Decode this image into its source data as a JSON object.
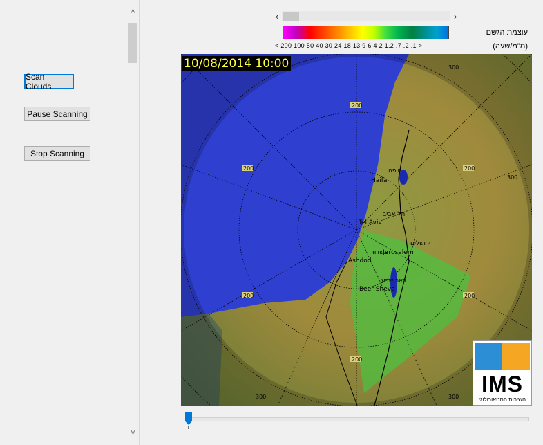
{
  "controls": {
    "scan_clouds": "Scan Clouds",
    "pause_scanning": "Pause Scanning",
    "stop_scanning": "Stop Scanning"
  },
  "legend": {
    "title": "עוצמת הגשם",
    "unit": "(מ\"מ/שעה)",
    "scale_labels": "< 200  100  50  40  30  24  18  13  9  6  4  2  1.2  .7  .2  .1  >"
  },
  "radar": {
    "timestamp": "10/08/2014 10:00",
    "range_labels": [
      "200",
      "200",
      "200",
      "200",
      "200",
      "200",
      "300",
      "300",
      "300",
      "300"
    ],
    "cities": [
      {
        "he": "חיפה",
        "en": "Haifa"
      },
      {
        "he": "תל אביב",
        "en": "Tel Aviv"
      },
      {
        "he": "ירושלים",
        "en": "Jerusalem"
      },
      {
        "he": "אשדוד",
        "en": "Ashdod"
      },
      {
        "he": "באר שבע",
        "en": "Beer Sheva"
      }
    ]
  },
  "logo": {
    "name": "IMS",
    "subtitle": "השירות המטאורולוגי"
  },
  "timeline": {
    "position": 0
  },
  "colors": {
    "accent": "#0078d7",
    "sea": "#2f3fd0",
    "land": "#7a8c3c"
  }
}
